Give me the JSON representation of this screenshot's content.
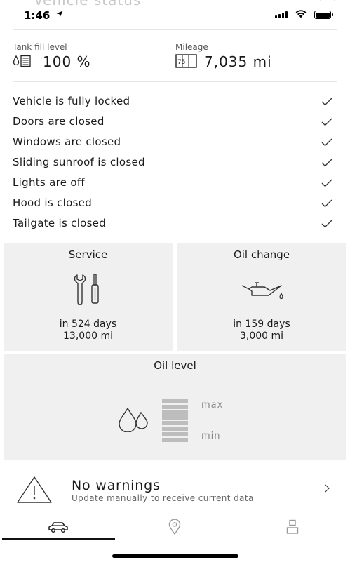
{
  "status_bar": {
    "time": "1:46",
    "header_title": "Vehicle status"
  },
  "stats": {
    "tank": {
      "label": "Tank fill level",
      "value": "100 %"
    },
    "mileage": {
      "label": "Mileage",
      "value": "7,035 mi",
      "icon_text": "75"
    }
  },
  "status_items": [
    {
      "label": "Vehicle is fully locked"
    },
    {
      "label": "Doors are closed"
    },
    {
      "label": "Windows are closed"
    },
    {
      "label": "Sliding sunroof is closed"
    },
    {
      "label": "Lights are off"
    },
    {
      "label": "Hood is closed"
    },
    {
      "label": "Tailgate is closed"
    }
  ],
  "tiles": {
    "service": {
      "title": "Service",
      "line1": "in 524 days",
      "line2": "13,000 mi"
    },
    "oil_change": {
      "title": "Oil change",
      "line1": "in 159 days",
      "line2": "3,000 mi"
    },
    "oil_level": {
      "title": "Oil level",
      "max_label": "max",
      "min_label": "min",
      "level_fraction": 1.0
    }
  },
  "warnings": {
    "title": "No warnings",
    "subtitle": "Update manually to receive current data"
  },
  "tabbar": {
    "tabs": [
      {
        "icon": "car-icon",
        "active": true
      },
      {
        "icon": "location-pin-icon",
        "active": false
      },
      {
        "icon": "user-icon",
        "active": false
      }
    ]
  }
}
